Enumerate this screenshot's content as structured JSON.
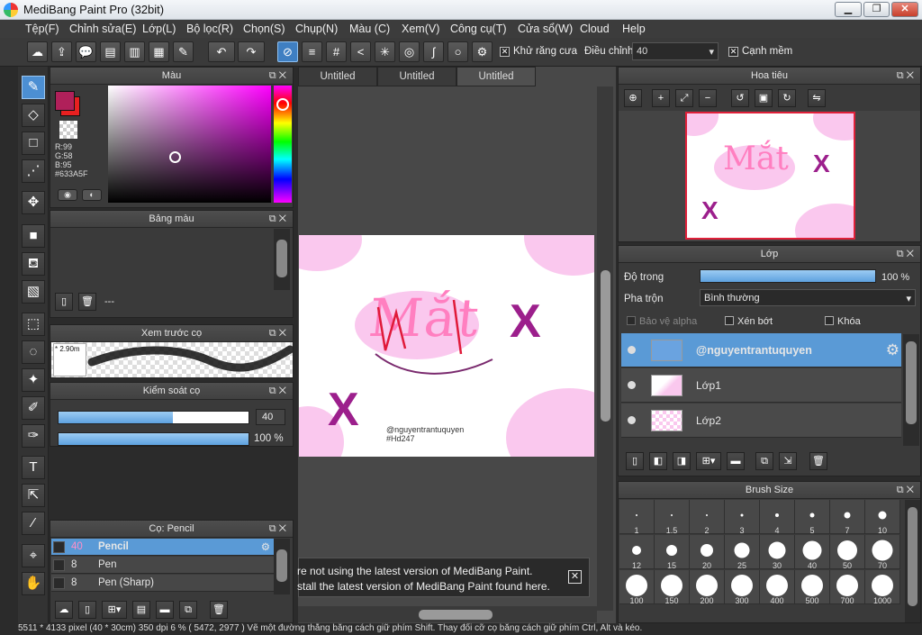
{
  "window": {
    "title": "MediBang Paint Pro (32bit)",
    "minimize": "▁",
    "maximize": "❐",
    "close": "✕"
  },
  "menu": [
    "Tệp(F)",
    "Chỉnh sửa(E)",
    "Lớp(L)",
    "Bộ lọc(R)",
    "Chọn(S)",
    "Chụp(N)",
    "Màu (C)",
    "Xem(V)",
    "Công cụ(T)",
    "Cửa sổ(W)",
    "Cloud",
    "Help"
  ],
  "toolbar": {
    "antialias_label": "Khử răng cưa",
    "correction_label": "Điều chỉnh",
    "correction_value": "40",
    "smooth_label": "Cạnh mềm",
    "antialias_checked": "✕",
    "smooth_checked": "✕"
  },
  "color_panel": {
    "title": "Màu",
    "r": "R:99",
    "g": "G:58",
    "b": "B:95",
    "hex": "#633A5F",
    "primary": "#b0205a",
    "secondary": "#e82020"
  },
  "palette_panel": {
    "title": "Bảng màu",
    "footer": "---"
  },
  "brush_preview_panel": {
    "title": "Xem trước cọ",
    "size": "* 2.90m"
  },
  "brush_control_panel": {
    "title": "Kiểm soát cọ",
    "size_value": "40",
    "size_fraction": 0.6,
    "opacity_value": "100 %",
    "opacity_fraction": 1.0
  },
  "brush_list_panel": {
    "title": "Cọ: Pencil",
    "items": [
      {
        "size": "40",
        "name": "Pencil",
        "selected": true
      },
      {
        "size": "8",
        "name": "Pen",
        "selected": false
      },
      {
        "size": "8",
        "name": "Pen (Sharp)",
        "selected": false
      }
    ]
  },
  "doc_tabs": [
    "Untitled",
    "Untitled",
    "Untitled"
  ],
  "canvas": {
    "watermark_line1": "@nguyentrantuquyen",
    "watermark_line2": "#Hd247",
    "lettering": "Mắt",
    "cross": "X"
  },
  "notification": {
    "line1": "re not using the latest version of MediBang Paint.",
    "line2": "stall the latest version of MediBang Paint found here.",
    "close": "✕"
  },
  "status_bar": "5511 * 4133 pixel   (40 * 30cm)   350 dpi   6 %   ( 5472, 2977 )   Vẽ một đường thẳng bằng cách giữ phím Shift. Thay đổi cỡ cọ bằng cách giữ phím Ctrl, Alt và kéo.",
  "navigator_panel": {
    "title": "Hoa tiêu"
  },
  "layer_panel": {
    "title": "Lớp",
    "opacity_label": "Độ trong",
    "opacity_value": "100 %",
    "opacity_fraction": 1.0,
    "blend_label": "Pha trộn",
    "blend_value": "Bình thường",
    "protect_alpha": "Bảo vệ alpha",
    "clipping": "Xén bớt",
    "lock": "Khóa",
    "layers": [
      {
        "name": "@nguyentrantuquyen",
        "selected": true
      },
      {
        "name": "Lớp1",
        "selected": false
      },
      {
        "name": "Lớp2",
        "selected": false
      }
    ]
  },
  "brush_size_panel": {
    "title": "Brush Size",
    "sizes": [
      "1",
      "1.5",
      "2",
      "3",
      "4",
      "5",
      "7",
      "10",
      "12",
      "15",
      "20",
      "25",
      "30",
      "40",
      "50",
      "70",
      "100",
      "150",
      "200",
      "300",
      "400",
      "500",
      "700",
      "1000"
    ]
  },
  "colors": {
    "accent": "#4c8fd3",
    "canvas_pink": "#fac8ee",
    "cross_purple": "#9c1f8c"
  }
}
